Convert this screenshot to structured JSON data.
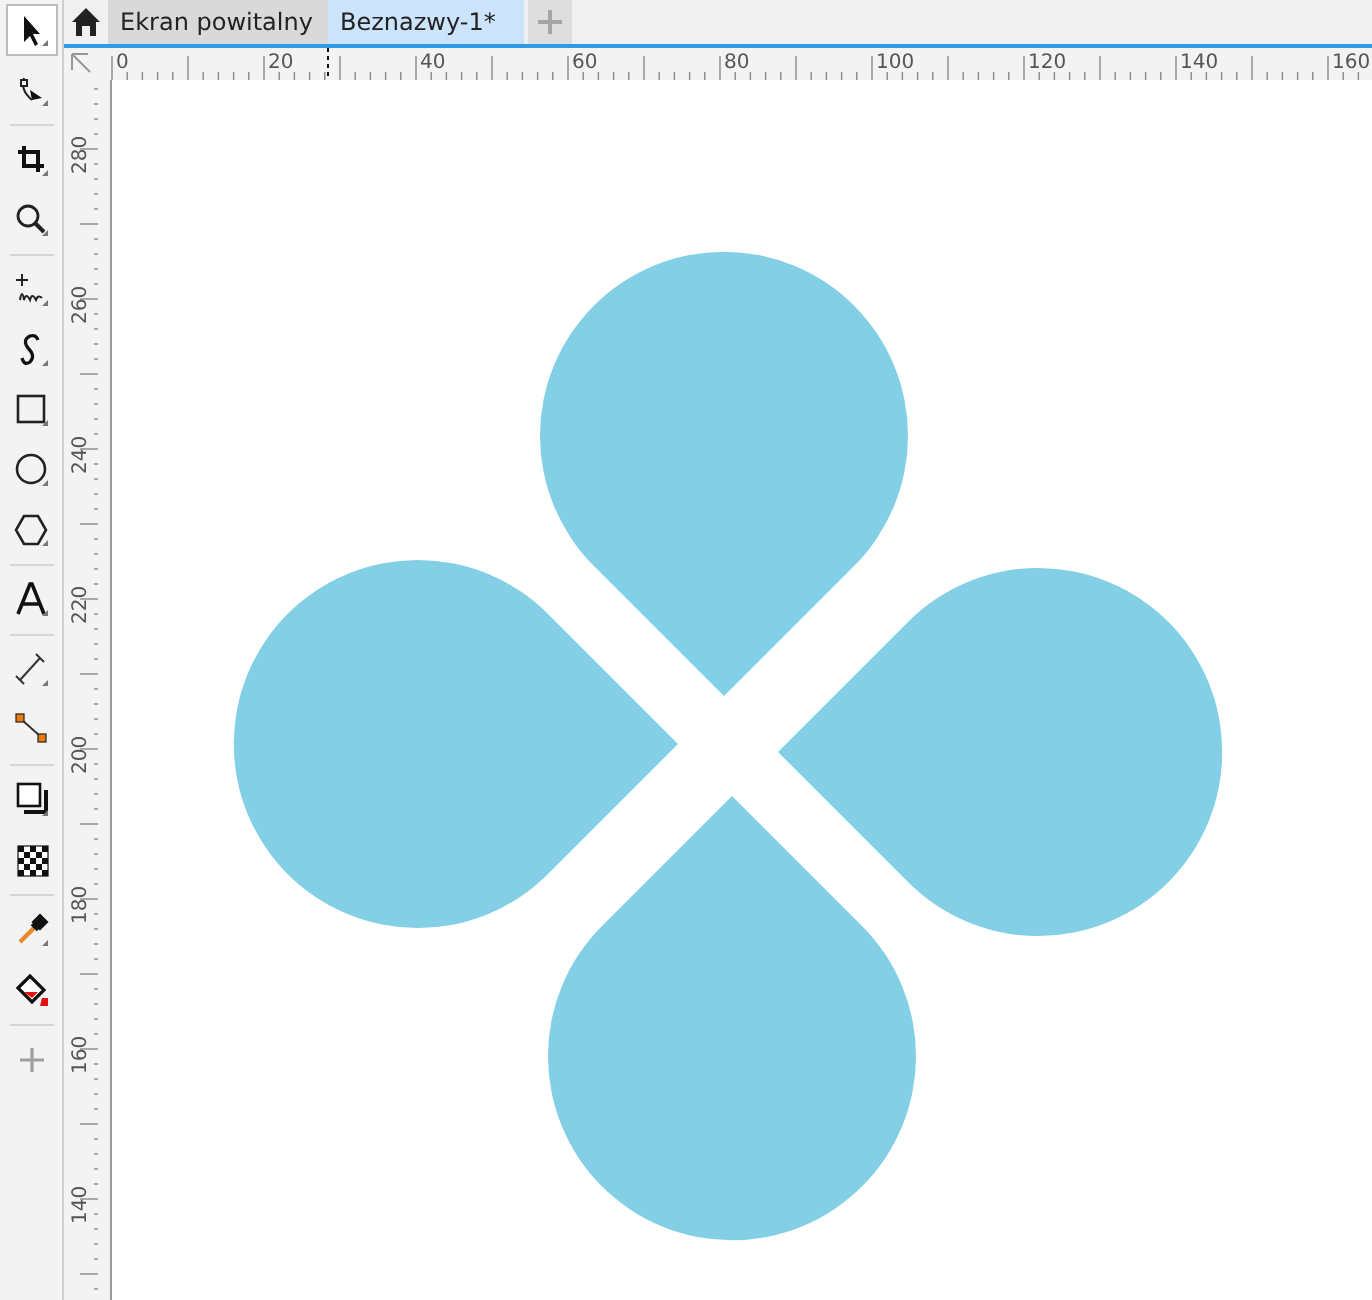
{
  "tabs": [
    {
      "label": "Ekran powitalny",
      "selected": false
    },
    {
      "label": "Beznazwy-1*",
      "selected": true
    }
  ],
  "toolbox": [
    {
      "kind": "pick",
      "selected": true
    },
    {
      "kind": "shape",
      "selected": false
    },
    {
      "kind": "separator"
    },
    {
      "kind": "crop",
      "selected": false
    },
    {
      "kind": "zoom",
      "selected": false
    },
    {
      "kind": "separator"
    },
    {
      "kind": "freehand",
      "selected": false
    },
    {
      "kind": "bezier",
      "selected": false
    },
    {
      "kind": "rectangle",
      "selected": false
    },
    {
      "kind": "ellipse",
      "selected": false
    },
    {
      "kind": "polygon",
      "selected": false
    },
    {
      "kind": "separator"
    },
    {
      "kind": "text",
      "selected": false
    },
    {
      "kind": "separator"
    },
    {
      "kind": "dimension",
      "selected": false
    },
    {
      "kind": "connector",
      "selected": false
    },
    {
      "kind": "separator"
    },
    {
      "kind": "shadow",
      "selected": false
    },
    {
      "kind": "transparency",
      "selected": false
    },
    {
      "kind": "separator"
    },
    {
      "kind": "eyedropper",
      "selected": false
    },
    {
      "kind": "fill",
      "selected": false
    },
    {
      "kind": "separator"
    },
    {
      "kind": "add",
      "selected": false
    }
  ],
  "horizontal_ruler": {
    "labels": [
      "0",
      "20",
      "40",
      "60",
      "80",
      "100",
      "120",
      "140",
      "160"
    ]
  },
  "vertical_ruler": {
    "labels": [
      "280",
      "260",
      "240",
      "220",
      "200",
      "180",
      "160",
      "140"
    ]
  }
}
